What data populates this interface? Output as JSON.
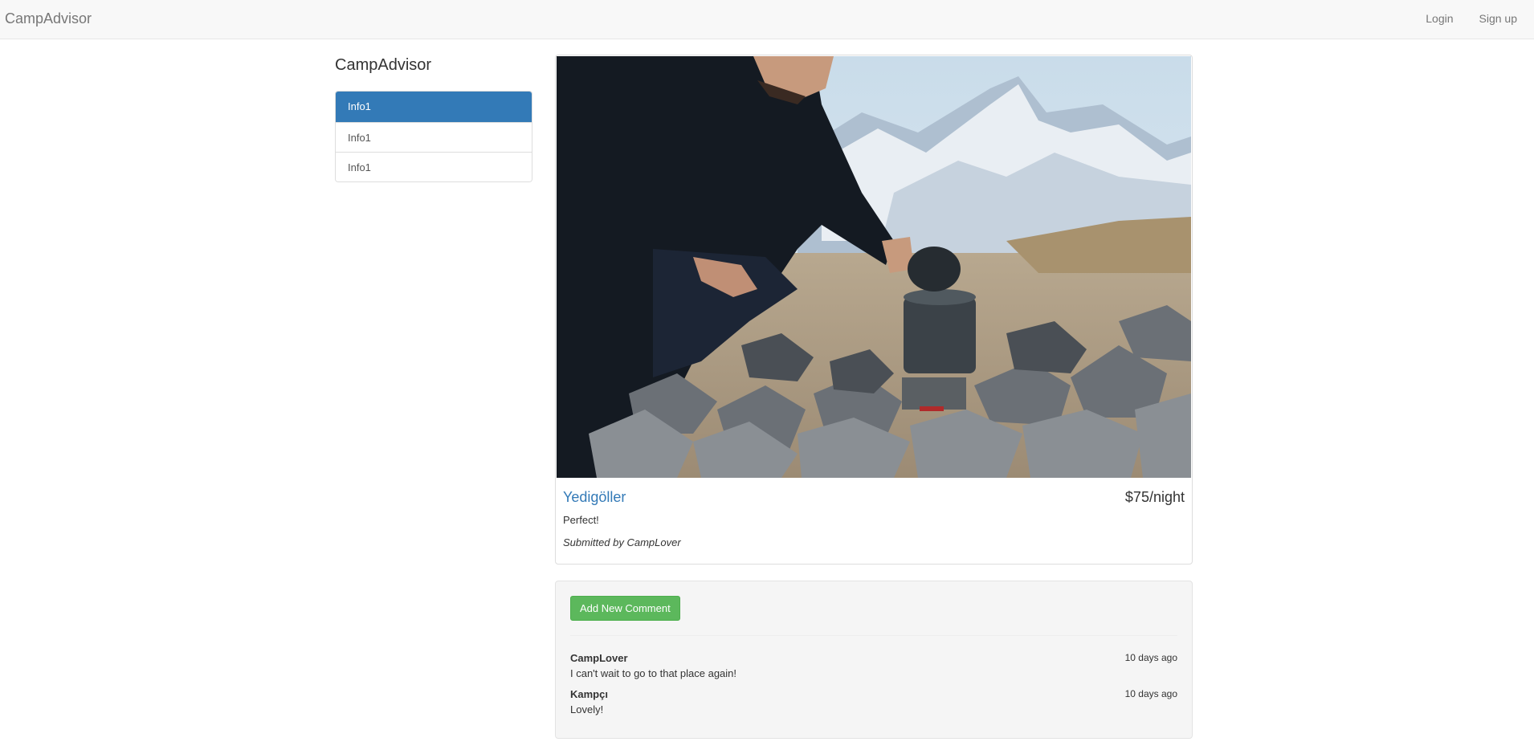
{
  "navbar": {
    "brand": "CampAdvisor",
    "login_label": "Login",
    "signup_label": "Sign up"
  },
  "sidebar": {
    "title": "CampAdvisor",
    "items": [
      {
        "label": "Info1",
        "active": true
      },
      {
        "label": "Info1",
        "active": false
      },
      {
        "label": "Info1",
        "active": false
      }
    ]
  },
  "campground": {
    "name": "Yedigöller",
    "price": "$75/night",
    "description": "Perfect!",
    "submitted_by": "Submitted by CampLover"
  },
  "comments": {
    "add_button_label": "Add New Comment",
    "items": [
      {
        "author": "CampLover",
        "time": "10 days ago",
        "text": "I can't wait to go to that place again!"
      },
      {
        "author": "Kampçı",
        "time": "10 days ago",
        "text": "Lovely!"
      }
    ]
  },
  "colors": {
    "primary": "#337ab7",
    "success": "#5cb85c",
    "navbar_bg": "#f8f8f8",
    "well_bg": "#f5f5f5"
  }
}
